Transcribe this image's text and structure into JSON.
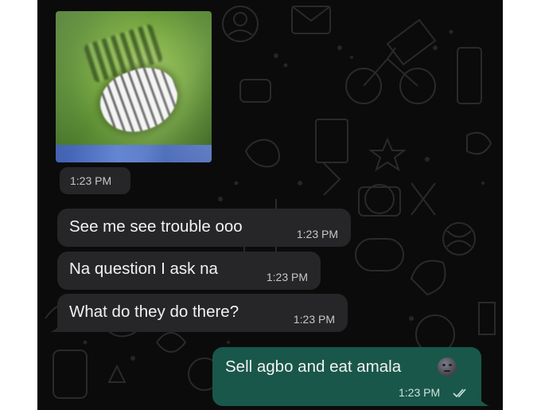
{
  "messages": [
    {
      "type": "sticker",
      "direction": "incoming",
      "time": "1:23 PM"
    },
    {
      "type": "text",
      "direction": "incoming",
      "text": "See me see trouble ooo",
      "time": "1:23 PM"
    },
    {
      "type": "text",
      "direction": "incoming",
      "text": "Na question I ask na",
      "time": "1:23 PM"
    },
    {
      "type": "text",
      "direction": "incoming",
      "text": "What do they do there?",
      "time": "1:23 PM"
    },
    {
      "type": "text",
      "direction": "outgoing",
      "text": "Sell agbo and eat amala",
      "emoji": "new-moon-face-emoji",
      "time": "1:23 PM",
      "status": "read-double-check"
    }
  ],
  "colors": {
    "chat_background": "#0b0b0b",
    "incoming_bubble": "#262628",
    "outgoing_bubble": "#19574a"
  }
}
